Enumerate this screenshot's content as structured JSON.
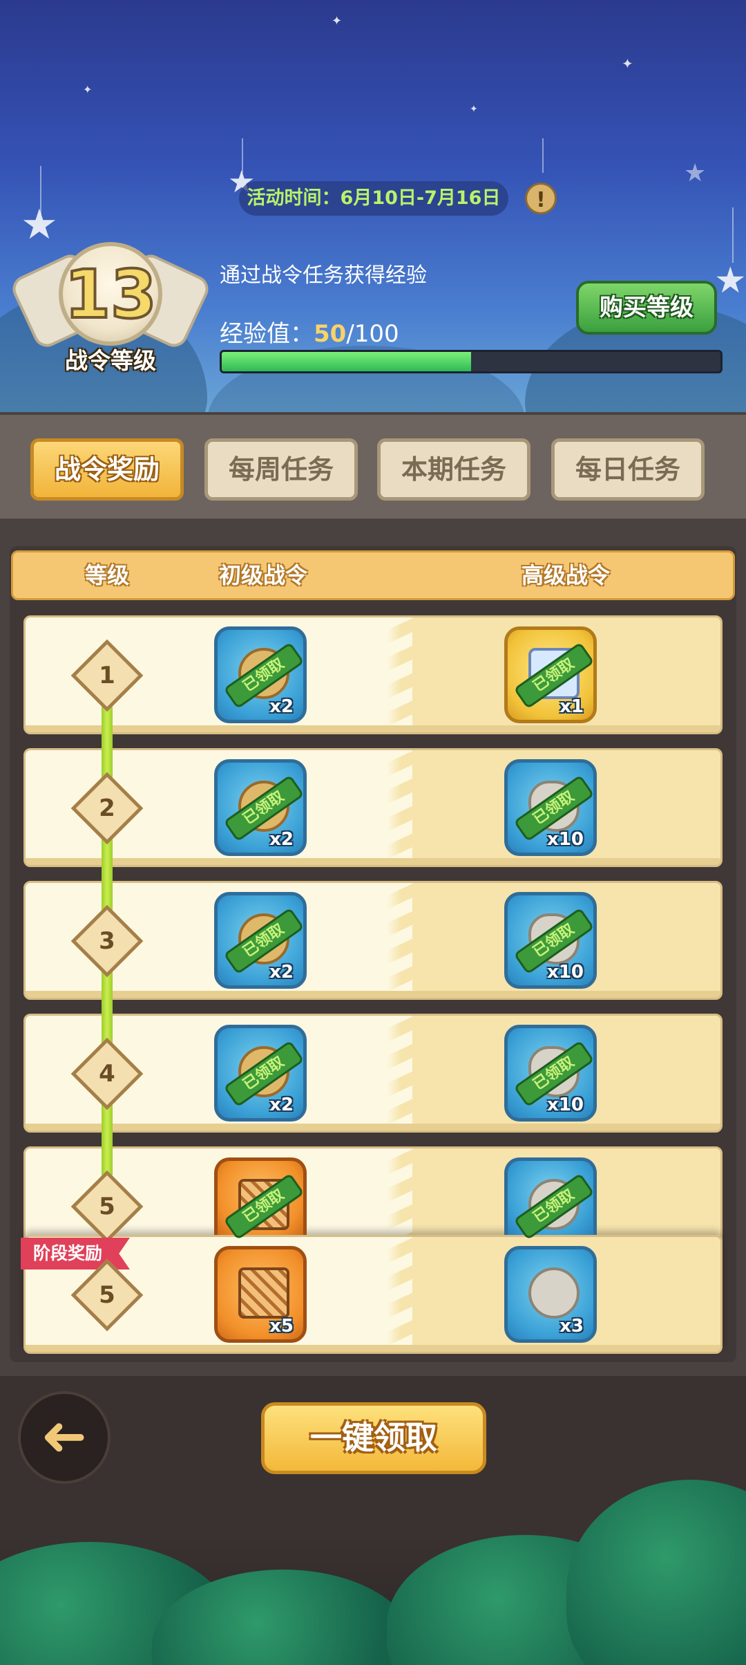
{
  "header": {
    "event_time": "活动时间：6月10日-7月16日",
    "info_icon": "!",
    "level_value": "13",
    "level_label": "战令等级",
    "exp_desc": "通过战令任务获得经验",
    "exp_label": "经验值：",
    "exp_current": "50",
    "exp_total": "/100",
    "exp_progress": 0.5,
    "buy_level_label": "购买等级"
  },
  "tabs": [
    {
      "label": "战令奖励",
      "active": true
    },
    {
      "label": "每周任务",
      "active": false
    },
    {
      "label": "本期任务",
      "active": false
    },
    {
      "label": "每日任务",
      "active": false
    }
  ],
  "table": {
    "col_level": "等级",
    "col_basic": "初级战令",
    "col_advanced": "高级战令",
    "claimed_text": "已领取",
    "rows": [
      {
        "level": "1",
        "basic_qty": "x2",
        "adv_qty": "x1"
      },
      {
        "level": "2",
        "basic_qty": "x2",
        "adv_qty": "x10"
      },
      {
        "level": "3",
        "basic_qty": "x2",
        "adv_qty": "x10"
      },
      {
        "level": "4",
        "basic_qty": "x2",
        "adv_qty": "x10"
      },
      {
        "level": "5",
        "basic_qty": "x5",
        "adv_qty": "x3"
      }
    ],
    "stage_reward": {
      "tag": "阶段奖励",
      "level": "5",
      "basic_qty": "x5",
      "adv_qty": "x3"
    }
  },
  "footer": {
    "back_icon": "back-arrow-icon",
    "claim_all_label": "一键领取"
  }
}
